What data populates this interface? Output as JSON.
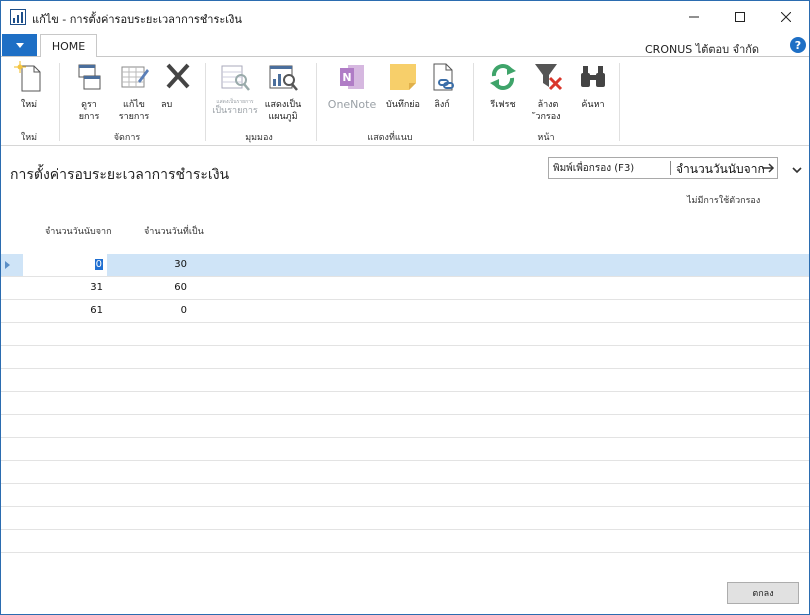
{
  "window": {
    "title": "แก้ไข - การตั้งค่ารอบระยะเวลาการชำระเงิน",
    "app_icon": "chart-app-icon",
    "controls": [
      "minimize-icon",
      "maximize-icon",
      "close-icon"
    ]
  },
  "ribbon_tabs": {
    "home_label": "HOME",
    "company": "CRONUS ไต้ตอบ จำกัด"
  },
  "ribbon": {
    "new_label": "ใหม่",
    "group_new": "ใหม่",
    "list_label_1": "ดูรา",
    "list_label_2": "ยการ",
    "edit_list_label_1": "แก้ไข",
    "edit_list_label_2": "รายการ",
    "delete_label": "ลบ",
    "group_manage": "จัดการ",
    "show_as_list_top": "แสดงเป็นรายการ",
    "show_as_list_1": "เป็นรายการ",
    "show_as_chart_1": "แสดงเป็น",
    "show_as_chart_2": "แผนภูมิ",
    "group_view": "มุมมอง",
    "onenote_label": "OneNote",
    "notes_label": "บันทึกย่อ",
    "links_label": "ลิงก์",
    "group_show_attached": "แสดงที่แนบ",
    "refresh_label": "รีเฟรช",
    "clear_filter_1": "ล้างต",
    "clear_filter_2": "ัวกรอง",
    "find_label": "ค้นหา",
    "group_page": "หน้า"
  },
  "page": {
    "title": "การตั้งค่ารอบระยะเวลาการชำระเงิน",
    "filter_placeholder": "พิมพ์เพื่อกรอง (F3)",
    "filter_field": "จำนวนวันนับจาก",
    "no_filter": "ไม่มีการใช้ตัวกรอง"
  },
  "grid": {
    "col_from": "จำนวนวันนับจาก",
    "col_to": "จำนวนวันที่เป็น",
    "rows": [
      {
        "from": "0",
        "to": "30"
      },
      {
        "from": "31",
        "to": "60"
      },
      {
        "from": "61",
        "to": "0"
      }
    ]
  },
  "footer": {
    "ok_label": "ตกลง"
  },
  "colors": {
    "accent": "#1e6fc5",
    "selected_row": "#cfe4f7"
  }
}
